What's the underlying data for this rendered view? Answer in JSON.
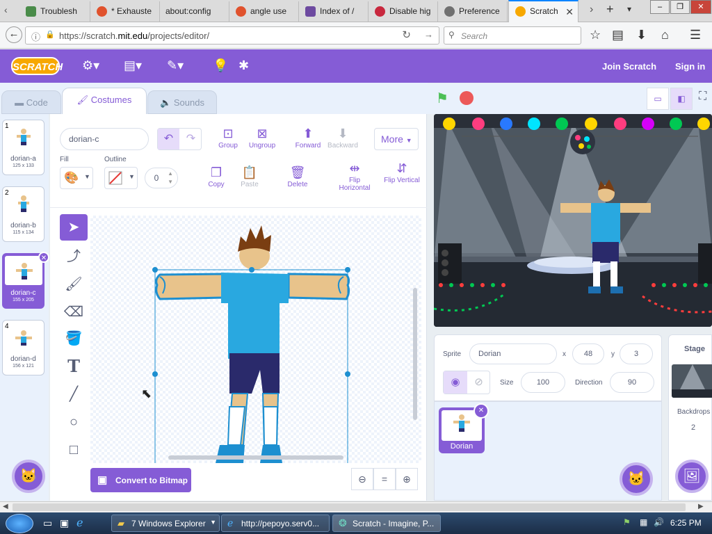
{
  "browser": {
    "tabs": [
      {
        "label": "Troublesh",
        "color": "#4a8c4a"
      },
      {
        "label": "* Exhauste",
        "color": "#e0522d"
      },
      {
        "label": "about:config",
        "color": ""
      },
      {
        "label": "angle use",
        "color": "#e0522d"
      },
      {
        "label": "Index of /",
        "color": "#6d4aa0"
      },
      {
        "label": "Disable hig",
        "color": "#c8283e"
      },
      {
        "label": "Preference",
        "color": "#707070"
      },
      {
        "label": "Scratch",
        "color": "#f7a800"
      }
    ],
    "url_host_pre": "https://scratch.",
    "url_host": "mit.edu",
    "url_path": "/projects/editor/",
    "search_placeholder": "Search"
  },
  "menubar": {
    "logo": "SCRATCH",
    "join": "Join Scratch",
    "signin": "Sign in"
  },
  "editor_tabs": {
    "code": "Code",
    "costumes": "Costumes",
    "sounds": "Sounds"
  },
  "costumes": [
    {
      "num": "1",
      "name": "dorian-a",
      "dims": "125 x 133"
    },
    {
      "num": "2",
      "name": "dorian-b",
      "dims": "115 x 134"
    },
    {
      "num": "3",
      "name": "dorian-c",
      "dims": "155 x 205"
    },
    {
      "num": "4",
      "name": "dorian-d",
      "dims": "156 x 121"
    }
  ],
  "paint": {
    "costume_name": "dorian-c",
    "fill_label": "Fill",
    "outline_label": "Outline",
    "outline_width": "0",
    "group": "Group",
    "ungroup": "Ungroup",
    "forward": "Forward",
    "backward": "Backward",
    "more": "More",
    "copy": "Copy",
    "paste": "Paste",
    "delete": "Delete",
    "flip_h": "Flip Horizontal",
    "flip_v": "Flip Vertical",
    "convert": "Convert to Bitmap"
  },
  "sprite": {
    "sprite_label": "Sprite",
    "name": "Dorian",
    "x_label": "x",
    "x": "48",
    "y_label": "y",
    "y": "3",
    "size_label": "Size",
    "size": "100",
    "direction_label": "Direction",
    "direction": "90",
    "thumb_label": "Dorian"
  },
  "stage": {
    "label": "Stage",
    "backdrops_label": "Backdrops",
    "backdrops_count": "2"
  },
  "taskbar": {
    "explorer": "7 Windows Explorer",
    "pepoyo": "http://pepoyo.serv0...",
    "scratch": "Scratch - Imagine, P...",
    "time": "6:25 PM"
  },
  "colors": {
    "scratch_purple": "#855cd6",
    "shirt": "#29a8e0",
    "skin": "#e8c38b"
  }
}
